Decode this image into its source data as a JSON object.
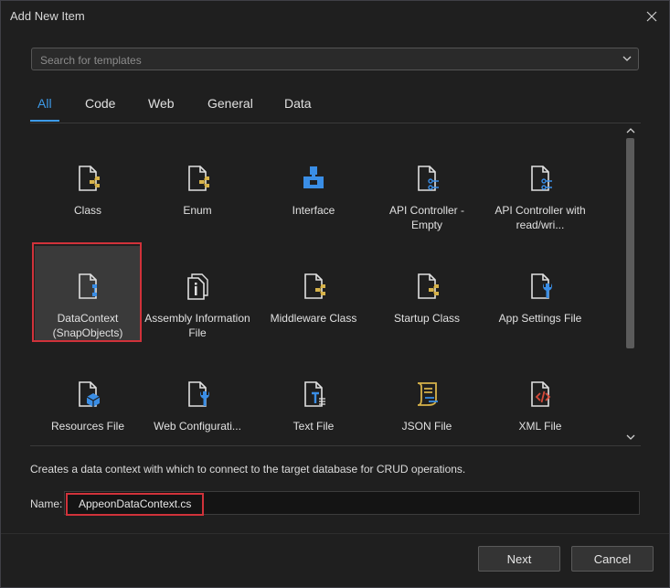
{
  "window": {
    "title": "Add New Item"
  },
  "search": {
    "placeholder": "Search for templates",
    "value": ""
  },
  "tabs": [
    {
      "label": "All",
      "active": true
    },
    {
      "label": "Code",
      "active": false
    },
    {
      "label": "Web",
      "active": false
    },
    {
      "label": "General",
      "active": false
    },
    {
      "label": "Data",
      "active": false
    }
  ],
  "templates": [
    {
      "label": "Class",
      "icon": "class-file-icon"
    },
    {
      "label": "Enum",
      "icon": "enum-file-icon"
    },
    {
      "label": "Interface",
      "icon": "interface-icon"
    },
    {
      "label": "API Controller - Empty",
      "icon": "api-controller-icon"
    },
    {
      "label": "API Controller with read/wri...",
      "icon": "api-controller-icon"
    },
    {
      "label": "DataContext (SnapObjects)",
      "icon": "datacontext-file-icon",
      "selected": true
    },
    {
      "label": "Assembly Information File",
      "icon": "assembly-info-icon"
    },
    {
      "label": "Middleware Class",
      "icon": "class-file-icon"
    },
    {
      "label": "Startup Class",
      "icon": "class-file-icon"
    },
    {
      "label": "App Settings File",
      "icon": "settings-file-icon"
    },
    {
      "label": "Resources File",
      "icon": "resources-file-icon"
    },
    {
      "label": "Web Configurati...",
      "icon": "web-config-icon"
    },
    {
      "label": "Text File",
      "icon": "text-file-icon"
    },
    {
      "label": "JSON File",
      "icon": "json-file-icon"
    },
    {
      "label": "XML File",
      "icon": "xml-file-icon"
    }
  ],
  "description": "Creates a data context with which to connect to the target database for CRUD operations.",
  "name_field": {
    "label": "Name:",
    "value": "AppeonDataContext.cs"
  },
  "buttons": {
    "next": "Next",
    "cancel": "Cancel"
  },
  "colors": {
    "accent": "#3d9be9",
    "highlight": "#d0323a",
    "icon_gold": "#d6b24a",
    "icon_blue": "#3a8ee6"
  }
}
